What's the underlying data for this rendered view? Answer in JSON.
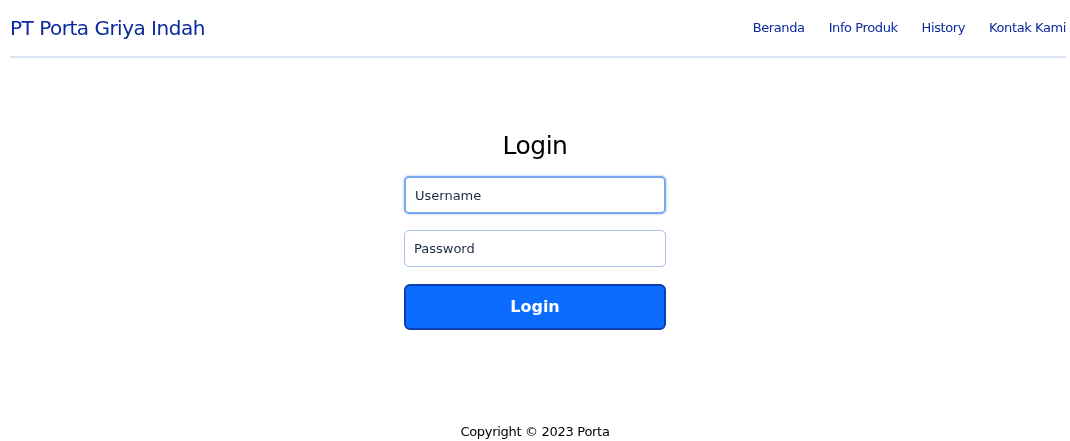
{
  "brand": "PT Porta Griya Indah",
  "nav": [
    {
      "label": "Beranda"
    },
    {
      "label": "Info Produk"
    },
    {
      "label": "History"
    },
    {
      "label": "Kontak Kami"
    }
  ],
  "login": {
    "title": "Login",
    "fields": [
      {
        "placeholder": "Username",
        "focused": true
      },
      {
        "placeholder": "Password",
        "focused": false
      }
    ],
    "button": "Login"
  },
  "footer": "Copyright © 2023 Porta"
}
